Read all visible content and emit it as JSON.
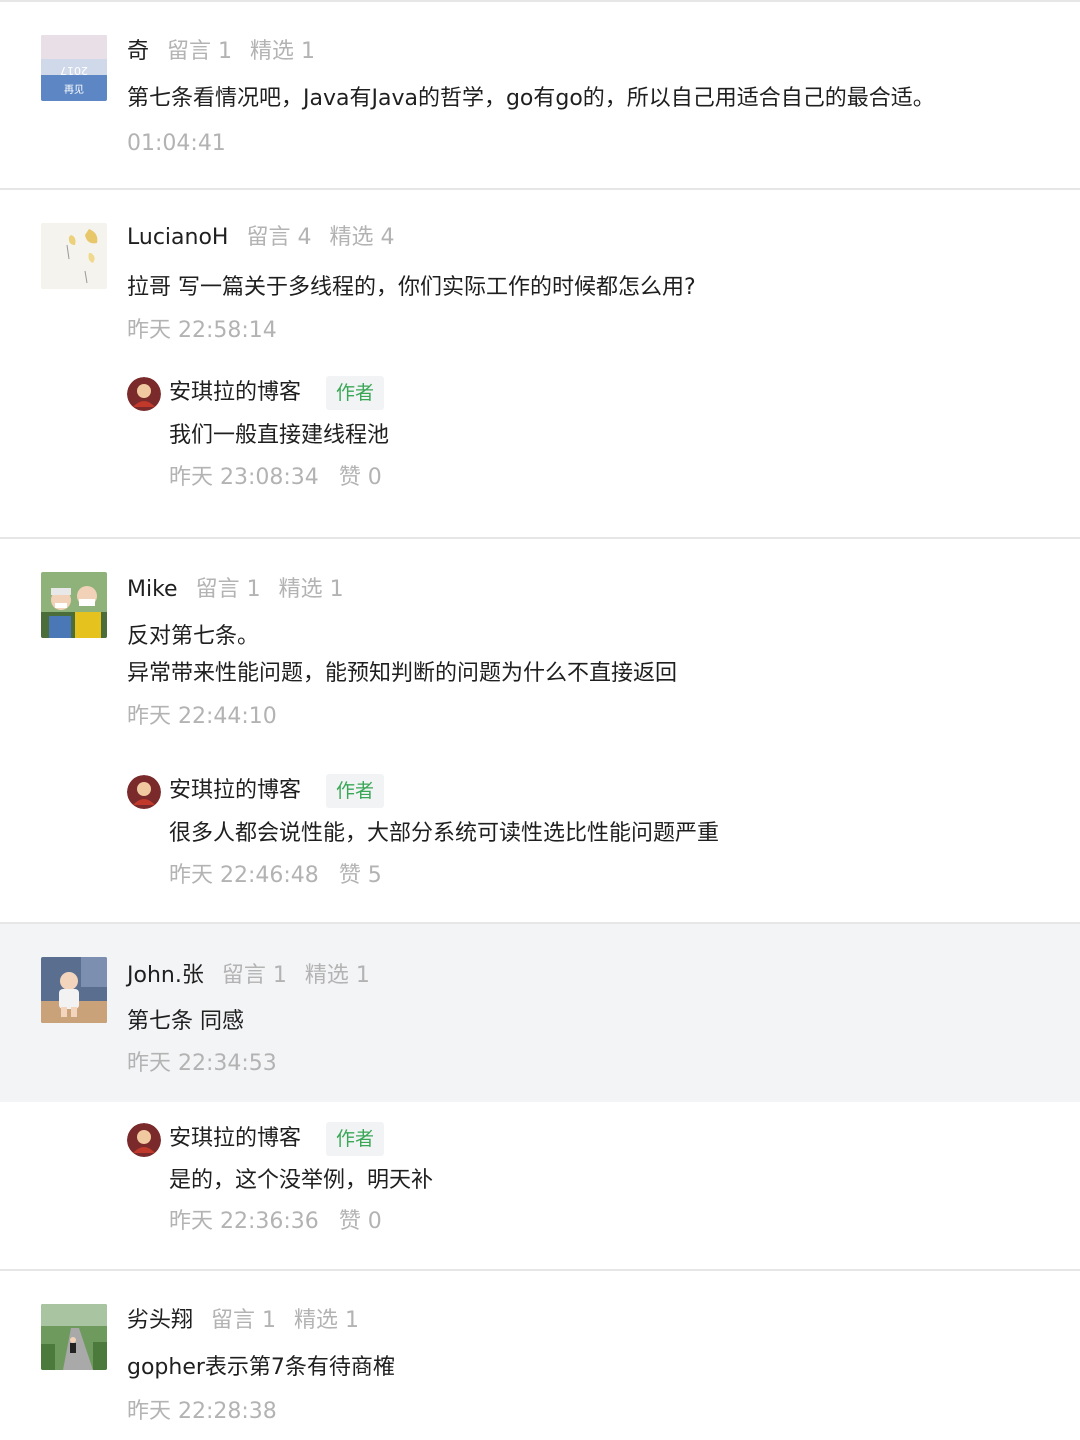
{
  "colors": {
    "divider": "#e6e6e6",
    "muted": "#b3b3b3",
    "author_badge": "#3aa757",
    "highlight_bg": "#f3f4f6"
  },
  "threads": [
    {
      "user": "奇",
      "messages_label": "留言 1",
      "picked_label": "精选 1",
      "content": [
        "第七条看情况吧，Java有Java的哲学，go有go的，所以自己用适合自己的最合适。"
      ],
      "time": "01:04:41",
      "avatar_icon": "blue-poster-avatar"
    },
    {
      "user": "LucianoH",
      "messages_label": "留言 4",
      "picked_label": "精选 4",
      "content": [
        "拉哥 写一篇关于多线程的，你们实际工作的时候都怎么用?"
      ],
      "time": "昨天 22:58:14",
      "avatar_icon": "ginkgo-leaf-avatar",
      "reply": {
        "author": "安琪拉的博客",
        "badge": "作者",
        "content": "我们一般直接建线程池",
        "time": "昨天 23:08:34",
        "likes": "赞 0"
      }
    },
    {
      "user": "Mike",
      "messages_label": "留言 1",
      "picked_label": "精选 1",
      "content": [
        "反对第七条。",
        "异常带来性能问题，能预知判断的问题为什么不直接返回"
      ],
      "time": "昨天 22:44:10",
      "avatar_icon": "two-people-avatar",
      "reply": {
        "author": "安琪拉的博客",
        "badge": "作者",
        "content": "很多人都会说性能，大部分系统可读性选比性能问题严重",
        "time": "昨天 22:46:48",
        "likes": "赞 5"
      }
    },
    {
      "user": "John.张",
      "messages_label": "留言 1",
      "picked_label": "精选 1",
      "content": [
        "第七条  同感"
      ],
      "time": "昨天 22:34:53",
      "avatar_icon": "child-avatar",
      "reply": {
        "author": "安琪拉的博客",
        "badge": "作者",
        "content": "是的，这个没举例，明天补",
        "time": "昨天 22:36:36",
        "likes": "赞 0"
      }
    },
    {
      "user": "劣头翔",
      "messages_label": "留言 1",
      "picked_label": "精选 1",
      "content": [
        "gopher表示第7条有待商榷"
      ],
      "time": "昨天 22:28:38",
      "avatar_icon": "park-path-avatar"
    }
  ]
}
